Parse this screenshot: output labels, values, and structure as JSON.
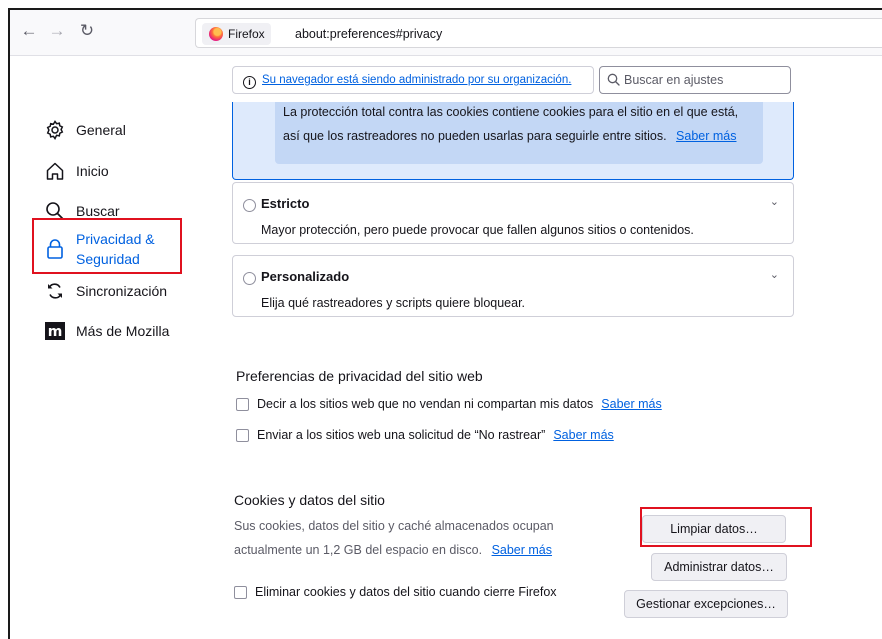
{
  "toolbar": {
    "back_icon": "arrow-left-icon",
    "forward_icon": "arrow-right-icon",
    "reload_icon": "reload-icon",
    "identity_label": "Firefox",
    "url": "about:preferences#privacy"
  },
  "sidebar": {
    "items": [
      {
        "id": "general",
        "label": "General",
        "icon": "gear-icon"
      },
      {
        "id": "inicio",
        "label": "Inicio",
        "icon": "home-icon"
      },
      {
        "id": "buscar",
        "label": "Buscar",
        "icon": "search-icon"
      },
      {
        "id": "privacidad",
        "label_line1": "Privacidad &",
        "label_line2": "Seguridad",
        "icon": "lock-icon",
        "selected": true
      },
      {
        "id": "sync",
        "label": "Sincronización",
        "icon": "sync-icon"
      },
      {
        "id": "mozilla",
        "label": "Más de Mozilla",
        "icon": "mozilla-logo-icon"
      }
    ]
  },
  "header": {
    "managed_notice": "Su navegador está siendo administrado por su organización.",
    "search_placeholder": "Buscar en ajustes"
  },
  "tracking": {
    "standard_text_line1": "La protección total contra las cookies contiene cookies para el sitio en el que está,",
    "standard_text_line2": "así que los rastreadores no pueden usarlas para seguirle entre sitios.",
    "standard_link": "Saber más",
    "strict_title": "Estricto",
    "strict_desc": "Mayor protección, pero puede provocar que fallen algunos sitios o contenidos.",
    "custom_title": "Personalizado",
    "custom_desc": "Elija qué rastreadores y scripts quiere bloquear."
  },
  "privacy_prefs": {
    "title": "Preferencias de privacidad del sitio web",
    "dnsell_label": "Decir a los sitios web que no vendan ni compartan mis datos",
    "dnsell_link": "Saber más",
    "dnt_label": "Enviar a los sitios web una solicitud de “No rastrear”",
    "dnt_link": "Saber más"
  },
  "cookies": {
    "title": "Cookies y datos del sitio",
    "desc_line1": "Sus cookies, datos del sitio y caché almacenados ocupan",
    "desc_line2": "actualmente un 1,2 GB del espacio en disco.",
    "desc_link": "Saber más",
    "delete_on_close_label": "Eliminar cookies y datos del sitio cuando cierre Firefox",
    "clear_data_button": "Limpiar datos…",
    "manage_data_button": "Administrar datos…",
    "manage_exceptions_button": "Gestionar excepciones…"
  },
  "colors": {
    "accent": "#0061e0",
    "highlight": "#e0111f"
  }
}
